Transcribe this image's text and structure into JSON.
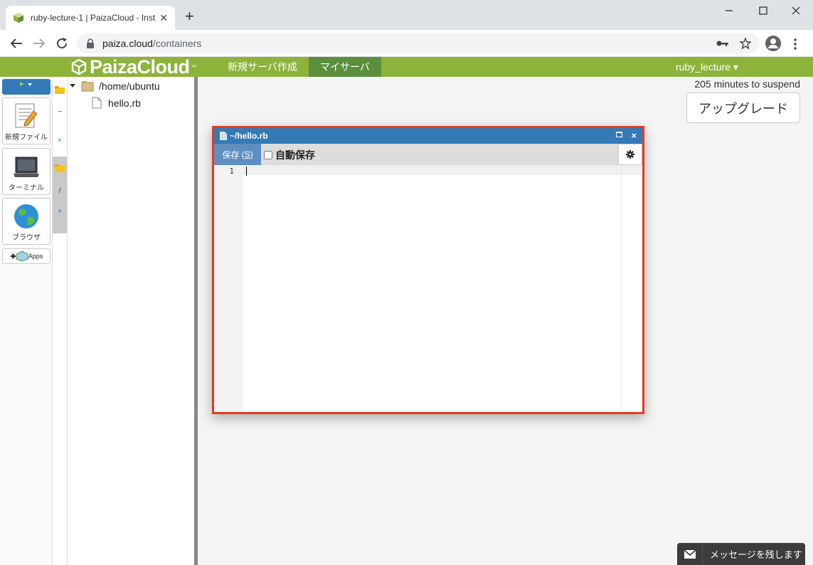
{
  "browser": {
    "tab_title": "ruby-lecture-1 | PaizaCloud - Inst",
    "tab_close": "✕",
    "new_tab": "+",
    "url_host": "paiza.cloud",
    "url_path": "/containers"
  },
  "header": {
    "logo_text": "PaizaCloud",
    "logo_tm": "™",
    "nav": [
      "新規サーバ作成",
      "マイサーバ"
    ],
    "active_nav": "マイサーバ",
    "user": "ruby_lecture ▾"
  },
  "dock": {
    "apps": [
      {
        "label": "新規ファイル",
        "icon": "new-file-icon"
      },
      {
        "label": "ターミナル",
        "icon": "terminal-icon"
      },
      {
        "label": "ブラウザ",
        "icon": "browser-globe-icon"
      }
    ],
    "apps_button": "Apps"
  },
  "vtabs": {
    "tilde": "~",
    "slash": "/",
    "close": "×"
  },
  "filetree": {
    "root": "/home/ubuntu",
    "files": [
      "hello.rb"
    ]
  },
  "main": {
    "suspend_text": "205 minutes to suspend",
    "upgrade_label": "アップグレード"
  },
  "editor": {
    "title": "~/hello.rb",
    "close": "×",
    "save_label": "保存",
    "save_shortcut": "S",
    "autosave_label": "自動保存",
    "line_numbers": [
      "1"
    ]
  },
  "message_widget": {
    "label": "メッセージを残します"
  },
  "colors": {
    "header_green": "#8db33a",
    "active_nav_green": "#5b8e3d",
    "editor_blue": "#337ab7",
    "highlight_red": "#e63a22"
  }
}
